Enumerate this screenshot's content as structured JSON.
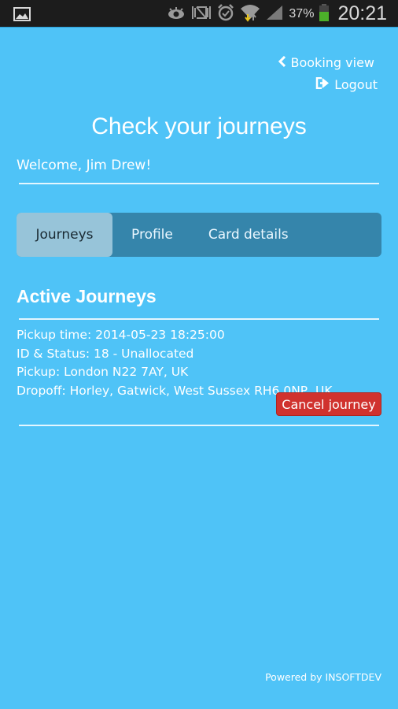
{
  "status_bar": {
    "notification_icon": "image-icon",
    "icons": [
      "eye-icon",
      "vibrate-off-icon",
      "alarm-icon",
      "wifi-icon",
      "signal-icon"
    ],
    "battery_percent": "37%",
    "battery_level": 0.37,
    "time": "20:21",
    "battery_color": "#4caf2a"
  },
  "top_links": {
    "booking_view": "Booking view",
    "logout": "Logout"
  },
  "header": {
    "title": "Check your journeys",
    "welcome": "Welcome, Jim Drew!"
  },
  "tabs": [
    {
      "label": "Journeys",
      "active": true
    },
    {
      "label": "Profile",
      "active": false
    },
    {
      "label": "Card details",
      "active": false
    }
  ],
  "active_journeys": {
    "title": "Active Journeys",
    "items": [
      {
        "pickup_time": "Pickup time: 2014-05-23 18:25:00",
        "id_status": "ID & Status: 18 - Unallocated",
        "pickup": "Pickup: London N22 7AY, UK",
        "dropoff": "Dropoff: Horley, Gatwick, West Sussex RH6 0NP, UK",
        "cancel_label": "Cancel journey"
      }
    ]
  },
  "footer": {
    "text": "Powered by INSOFTDEV"
  },
  "colors": {
    "background": "#4fc3f7",
    "tab_bar": "#3585ab",
    "tab_active": "#97c4d9",
    "cancel": "#d0322e"
  }
}
